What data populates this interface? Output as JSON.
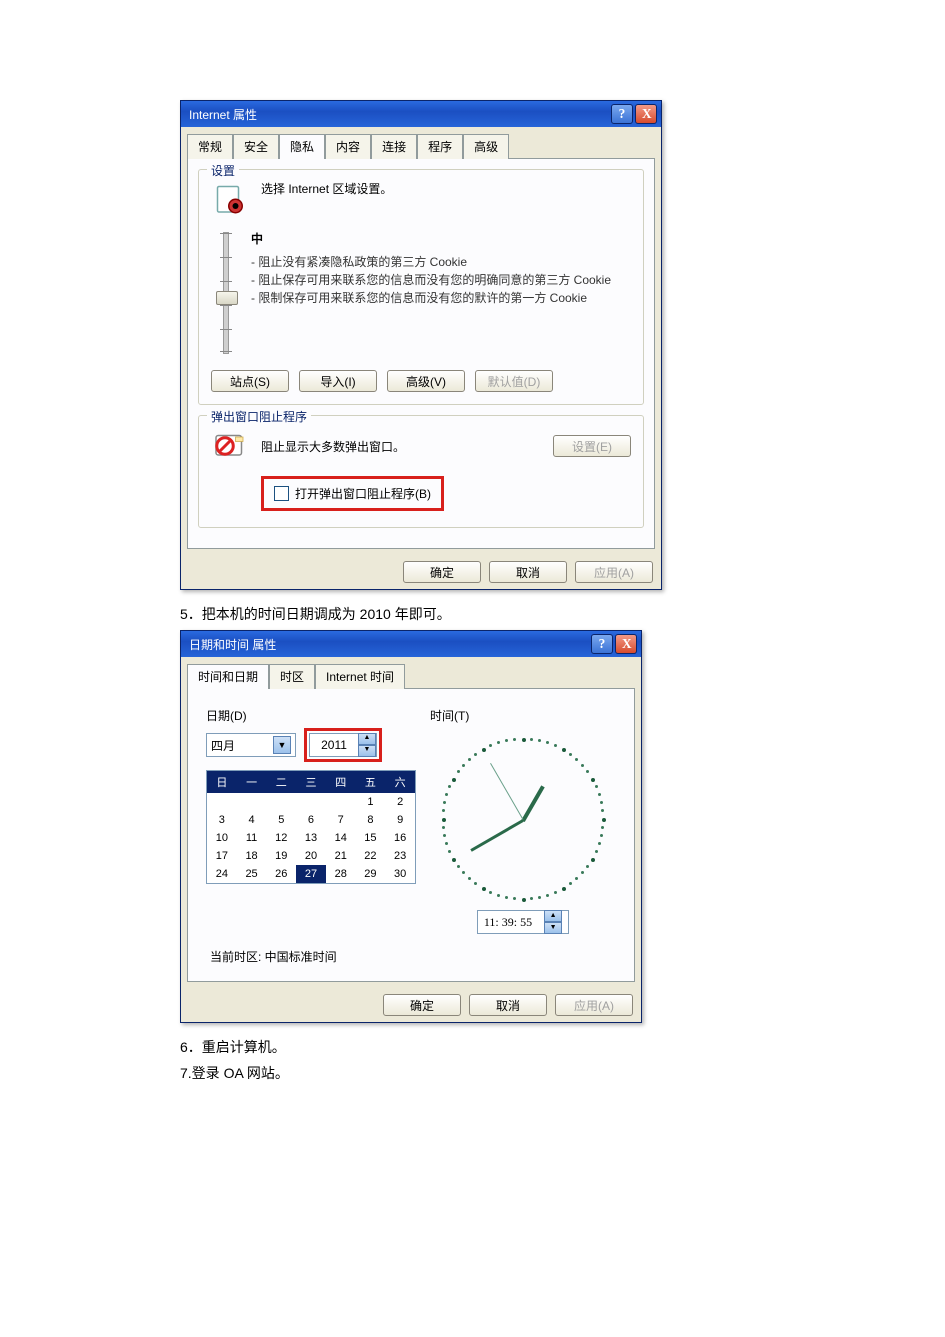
{
  "step5": "5．把本机的时间日期调成为 2010 年即可。",
  "step6": "6．重启计算机。",
  "step7": "7.登录 OA 网站。",
  "dlg1": {
    "title": "Internet 属性",
    "tabs": [
      "常规",
      "安全",
      "隐私",
      "内容",
      "连接",
      "程序",
      "高级"
    ],
    "active_tab": 2,
    "settings_legend": "设置",
    "settings_intro": "选择 Internet 区域设置。",
    "level": "中",
    "bullets": [
      "- 阻止没有紧凑隐私政策的第三方 Cookie",
      "- 阻止保存可用来联系您的信息而没有您的明确同意的第三方 Cookie",
      "- 限制保存可用来联系您的信息而没有您的默许的第一方 Cookie"
    ],
    "btn_sites": "站点(S)",
    "btn_import": "导入(I)",
    "btn_advanced": "高级(V)",
    "btn_default": "默认值(D)",
    "popup_legend": "弹出窗口阻止程序",
    "popup_intro": "阻止显示大多数弹出窗口。",
    "btn_popup_settings": "设置(E)",
    "popup_checkbox": "打开弹出窗口阻止程序(B)",
    "ok": "确定",
    "cancel": "取消",
    "apply": "应用(A)"
  },
  "dlg2": {
    "title": "日期和时间 属性",
    "tabs": [
      "时间和日期",
      "时区",
      "Internet 时间"
    ],
    "active_tab": 0,
    "date_label": "日期(D)",
    "time_label": "时间(T)",
    "month": "四月",
    "year": "2011",
    "weekdays": [
      "日",
      "一",
      "二",
      "三",
      "四",
      "五",
      "六"
    ],
    "cal_rows": [
      [
        "",
        "",
        "",
        "",
        "",
        "1",
        "2"
      ],
      [
        "3",
        "4",
        "5",
        "6",
        "7",
        "8",
        "9"
      ],
      [
        "10",
        "11",
        "12",
        "13",
        "14",
        "15",
        "16"
      ],
      [
        "17",
        "18",
        "19",
        "20",
        "21",
        "22",
        "23"
      ],
      [
        "24",
        "25",
        "26",
        "27",
        "28",
        "29",
        "30"
      ]
    ],
    "selected_day": "27",
    "time_value": "11: 39: 55",
    "tz_line": "当前时区: 中国标准时间",
    "ok": "确定",
    "cancel": "取消",
    "apply": "应用(A)"
  }
}
